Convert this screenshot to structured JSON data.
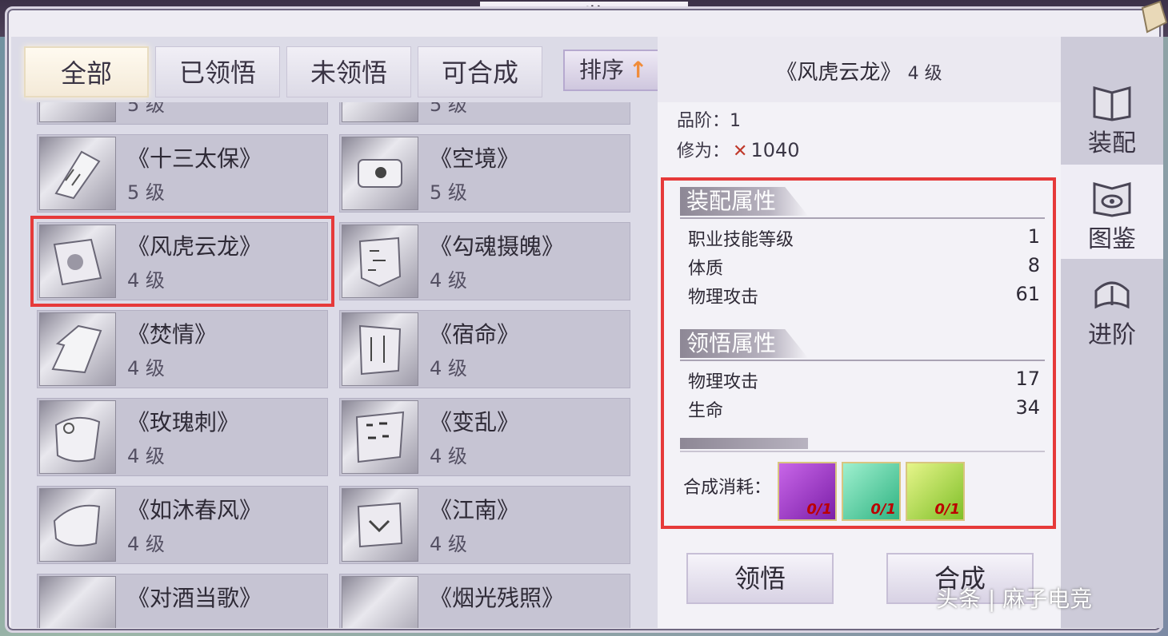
{
  "window": {
    "title": "图鉴"
  },
  "tabs": [
    {
      "label": "全部",
      "active": true
    },
    {
      "label": "已领悟",
      "active": false
    },
    {
      "label": "未领悟",
      "active": false
    },
    {
      "label": "可合成",
      "active": false
    }
  ],
  "sort_button": {
    "label": "排序",
    "arrow": "↑"
  },
  "skill_list": [
    {
      "name": "",
      "level": "5 级",
      "partial": true
    },
    {
      "name": "",
      "level": "5 级",
      "partial": true
    },
    {
      "name": "《十三太保》",
      "level": "5 级"
    },
    {
      "name": "《空境》",
      "level": "5 级"
    },
    {
      "name": "《风虎云龙》",
      "level": "4 级",
      "selected": true
    },
    {
      "name": "《勾魂摄魄》",
      "level": "4 级"
    },
    {
      "name": "《焚情》",
      "level": "4 级"
    },
    {
      "name": "《宿命》",
      "level": "4 级"
    },
    {
      "name": "《玫瑰刺》",
      "level": "4 级"
    },
    {
      "name": "《变乱》",
      "level": "4 级"
    },
    {
      "name": "《如沐春风》",
      "level": "4 级"
    },
    {
      "name": "《江南》",
      "level": "4 级"
    },
    {
      "name": "《对酒当歌》",
      "level": ""
    },
    {
      "name": "《烟光残照》",
      "level": ""
    }
  ],
  "detail": {
    "title": "《风虎云龙》",
    "level": "4 级",
    "grade_label": "品阶：",
    "grade_value": "1",
    "cultivation_label": "修为：",
    "cultivation_value": "1040",
    "equip_section": {
      "title": "装配属性",
      "rows": [
        {
          "label": "职业技能等级",
          "value": "1"
        },
        {
          "label": "体质",
          "value": "8"
        },
        {
          "label": "物理攻击",
          "value": "61"
        }
      ]
    },
    "comprehend_section": {
      "title": "领悟属性",
      "rows": [
        {
          "label": "物理攻击",
          "value": "17"
        },
        {
          "label": "生命",
          "value": "34"
        }
      ]
    },
    "consume_label": "合成消耗：",
    "materials": [
      {
        "count": "0/1",
        "color": "#9b2fc9"
      },
      {
        "count": "0/1",
        "color": "#3fcf9a"
      },
      {
        "count": "0/1",
        "color": "#9bd23a"
      }
    ],
    "buttons": {
      "comprehend": "领悟",
      "synthesize": "合成"
    }
  },
  "side_nav": [
    {
      "label": "装配",
      "icon": "equip-book-icon",
      "active": false
    },
    {
      "label": "图鉴",
      "icon": "codex-eye-icon",
      "active": true
    },
    {
      "label": "进阶",
      "icon": "advance-book-icon",
      "active": false
    }
  ],
  "watermark": "头条 | 麻子电竞",
  "colors": {
    "highlight_red": "#e63a3a",
    "panel_bg": "#dcdbe7",
    "accent_orange": "#f08c3a"
  }
}
